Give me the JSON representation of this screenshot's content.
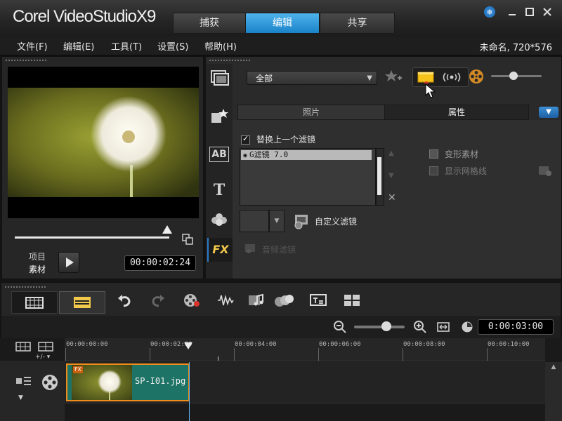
{
  "app": {
    "logo": "Corel VideoStudioX9",
    "project_info": "未命名, 720*576"
  },
  "mode_tabs": [
    {
      "label": "捕获",
      "active": false
    },
    {
      "label": "编辑",
      "active": true
    },
    {
      "label": "共享",
      "active": false
    }
  ],
  "menu": [
    {
      "label": "文件(F)"
    },
    {
      "label": "编辑(E)"
    },
    {
      "label": "工具(T)"
    },
    {
      "label": "设置(S)"
    },
    {
      "label": "帮助(H)"
    }
  ],
  "preview": {
    "mode_project": "项目",
    "mode_clip": "素材",
    "timecode": "00:00:02:24",
    "scrub_position": 0.98
  },
  "library": {
    "category": "全部",
    "tab_photo": "照片",
    "tab_properties": "属性",
    "replace_filter_label": "替换上一个滤镜",
    "replace_filter_checked": true,
    "filter_items": [
      "G滤镜 7.0"
    ],
    "deform_clip_label": "变形素材",
    "show_grid_label": "显示网格线",
    "custom_filter_label": "自定义滤镜",
    "audio_filter_label": "音频滤镜"
  },
  "timeline": {
    "duration": "0:00:03:00",
    "ruler_labels": [
      "00:00:00:00",
      "00:00:02:00",
      "00:00:04:00",
      "00:00:06:00",
      "00:00:08:00",
      "00:00:10:00"
    ],
    "track_add_remove": "+/-",
    "clip_label": "SP-I01.jpg",
    "clip_fx_badge": "FX",
    "zoom_level": 0.6
  },
  "icons": {
    "fx_panel": "FX",
    "text_panel": "T",
    "title_panel": "AB"
  },
  "colors": {
    "accent_blue": "#1a83c9",
    "clip_border": "#f08c1a",
    "clip_fill": "#1d7466"
  }
}
